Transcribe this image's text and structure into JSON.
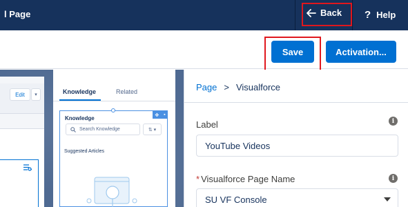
{
  "header": {
    "title": "l Page",
    "back_label": "Back",
    "help_label": "Help"
  },
  "toolbar": {
    "save_label": "Save",
    "activation_label": "Activation..."
  },
  "canvas": {
    "left_card": {
      "edit_label": "Edit",
      "dropdown_glyph": "▾"
    },
    "right_card": {
      "tabs": [
        {
          "label": "Knowledge",
          "active": true
        },
        {
          "label": "Related",
          "active": false
        }
      ],
      "component": {
        "title": "Knowledge",
        "search_placeholder": "Search Knowledge",
        "suggested_label": "Suggested Articles"
      }
    }
  },
  "panel": {
    "breadcrumb": {
      "parent": "Page",
      "separator": ">",
      "current": "Visualforce"
    },
    "fields": [
      {
        "label": "Label",
        "value": "YouTube Videos",
        "required": false,
        "type": "text"
      },
      {
        "label": "Visualforce Page Name",
        "value": "SU VF Console",
        "required": true,
        "type": "select"
      }
    ]
  },
  "colors": {
    "header_bg": "#16325c",
    "brand_blue": "#0070d2",
    "highlight_red": "#e0171d"
  },
  "icons": [
    "arrow-left-icon",
    "question-mark-icon",
    "info-icon",
    "chevron-down-icon",
    "search-icon",
    "sort-icon",
    "move-icon",
    "delete-icon",
    "list-icon"
  ]
}
